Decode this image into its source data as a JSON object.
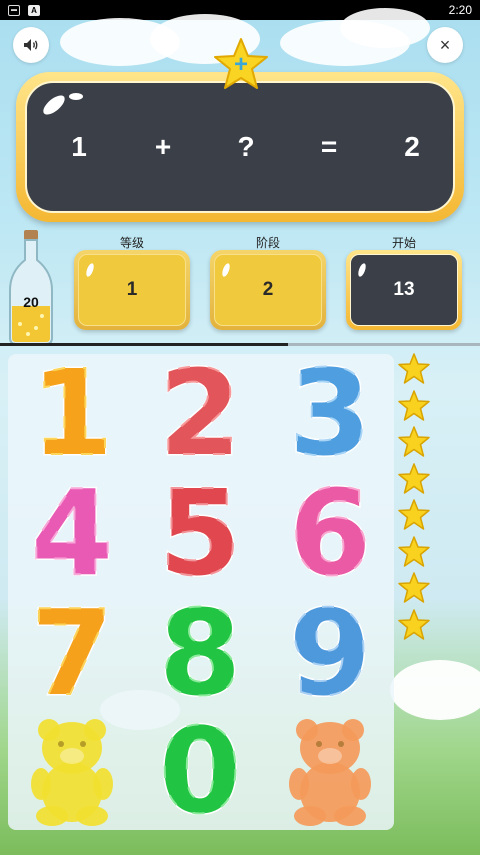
{
  "status_bar": {
    "time": "2:20",
    "left_icon": "notification-icon",
    "a_icon": "A"
  },
  "toolbar": {
    "sound_icon": "speaker-icon",
    "close_icon": "close-icon",
    "close_glyph": "×"
  },
  "equation": {
    "term1": "1",
    "operator": "+",
    "unknown": "?",
    "equals": "=",
    "result": "2"
  },
  "badge": {
    "icon": "star-plus-icon",
    "symbol": "+"
  },
  "bottle": {
    "count": "20"
  },
  "stats": [
    {
      "label": "等级",
      "value": "1",
      "style": "yellow"
    },
    {
      "label": "阶段",
      "value": "2",
      "style": "yellow"
    },
    {
      "label": "开始",
      "value": "13",
      "style": "dark"
    }
  ],
  "progress": {
    "fraction": 0.6
  },
  "digits": [
    {
      "digit": "1",
      "color": "#f7a21b",
      "stroke": "#fcd65a"
    },
    {
      "digit": "2",
      "color": "#e2555a",
      "stroke": "#f69a9c"
    },
    {
      "digit": "3",
      "color": "#4f9ee0",
      "stroke": "#a8d4f6"
    },
    {
      "digit": "4",
      "color": "#e95ab5",
      "stroke": "#f7a8d8"
    },
    {
      "digit": "5",
      "color": "#e0474f",
      "stroke": "#f2959a"
    },
    {
      "digit": "6",
      "color": "#ea5aa5",
      "stroke": "#f8a6cf"
    },
    {
      "digit": "7",
      "color": "#f5a11c",
      "stroke": "#fcd35a"
    },
    {
      "digit": "8",
      "color": "#22c443",
      "stroke": "#8cea9c"
    },
    {
      "digit": "9",
      "color": "#4e98dc",
      "stroke": "#a8d0f4"
    },
    {
      "digit": "0",
      "color": "#22c443",
      "stroke": "#8cea9c"
    }
  ],
  "bears": [
    {
      "name": "yellow-gummy-bear",
      "color": "#f2e030"
    },
    {
      "name": "orange-gummy-bear",
      "color": "#f49a5a"
    }
  ],
  "progress_stars": {
    "count": 8,
    "color": "#f8d21e"
  }
}
